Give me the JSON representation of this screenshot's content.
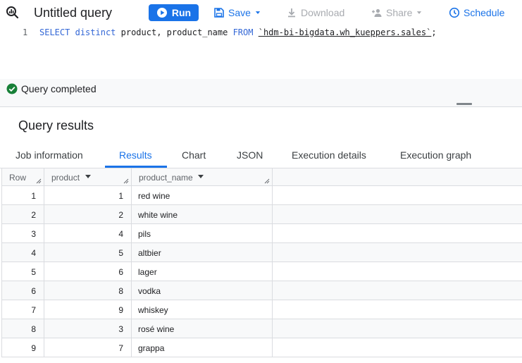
{
  "toolbar": {
    "title": "Untitled query",
    "run_label": "Run",
    "save_label": "Save",
    "download_label": "Download",
    "share_label": "Share",
    "schedule_label": "Schedule"
  },
  "editor": {
    "line_number": "1",
    "kw_select": "SELECT",
    "kw_distinct": "distinct",
    "columns": "product, product_name",
    "kw_from": "FROM",
    "table_ref": "`hdm-bi-bigdata.wh_kueppers.sales`",
    "terminator": ";"
  },
  "status": {
    "text": "Query completed"
  },
  "results": {
    "title": "Query results",
    "tabs": [
      {
        "label": "Job information"
      },
      {
        "label": "Results"
      },
      {
        "label": "Chart"
      },
      {
        "label": "JSON"
      },
      {
        "label": "Execution details"
      },
      {
        "label": "Execution graph"
      }
    ],
    "active_tab": "Results",
    "columns": [
      "Row",
      "product",
      "product_name"
    ],
    "rows": [
      {
        "row": "1",
        "product": "1",
        "product_name": "red wine"
      },
      {
        "row": "2",
        "product": "2",
        "product_name": "white wine"
      },
      {
        "row": "3",
        "product": "4",
        "product_name": "pils"
      },
      {
        "row": "4",
        "product": "5",
        "product_name": "altbier"
      },
      {
        "row": "5",
        "product": "6",
        "product_name": "lager"
      },
      {
        "row": "6",
        "product": "8",
        "product_name": "vodka"
      },
      {
        "row": "7",
        "product": "9",
        "product_name": "whiskey"
      },
      {
        "row": "8",
        "product": "3",
        "product_name": "rosé wine"
      },
      {
        "row": "9",
        "product": "7",
        "product_name": "grappa"
      }
    ]
  },
  "colors": {
    "accent": "#1a73e8",
    "success": "#188038",
    "disabled": "#a8abb0"
  }
}
